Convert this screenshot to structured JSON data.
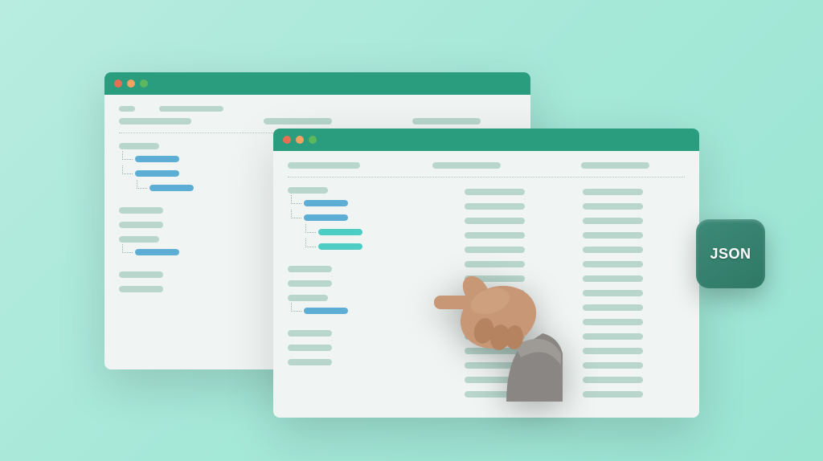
{
  "badge": {
    "label": "JSON"
  },
  "colors": {
    "windowHeader": "#2a9d7f",
    "windowBody": "#f0f5f3",
    "pillDefault": "#b8d6cc",
    "pillBlue": "#5daed4",
    "pillTeal": "#4ecdc4",
    "badgeBg": "#3d8a77",
    "background": "#a5e8d8"
  },
  "windows": {
    "back": {
      "trafficLights": [
        "red",
        "yellow",
        "green"
      ]
    },
    "front": {
      "trafficLights": [
        "red",
        "yellow",
        "green"
      ]
    }
  }
}
